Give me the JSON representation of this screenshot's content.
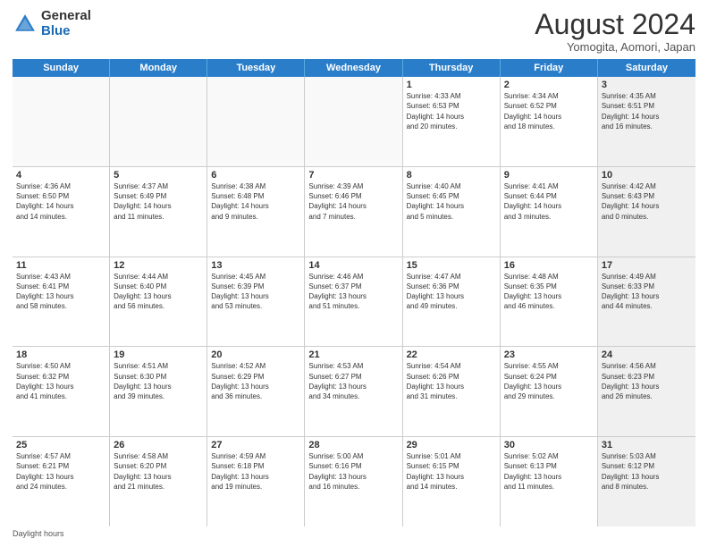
{
  "header": {
    "logo_general": "General",
    "logo_blue": "Blue",
    "month_year": "August 2024",
    "location": "Yomogita, Aomori, Japan"
  },
  "days_of_week": [
    "Sunday",
    "Monday",
    "Tuesday",
    "Wednesday",
    "Thursday",
    "Friday",
    "Saturday"
  ],
  "weeks": [
    [
      {
        "num": "",
        "text": "",
        "empty": true
      },
      {
        "num": "",
        "text": "",
        "empty": true
      },
      {
        "num": "",
        "text": "",
        "empty": true
      },
      {
        "num": "",
        "text": "",
        "empty": true
      },
      {
        "num": "1",
        "text": "Sunrise: 4:33 AM\nSunset: 6:53 PM\nDaylight: 14 hours\nand 20 minutes."
      },
      {
        "num": "2",
        "text": "Sunrise: 4:34 AM\nSunset: 6:52 PM\nDaylight: 14 hours\nand 18 minutes."
      },
      {
        "num": "3",
        "text": "Sunrise: 4:35 AM\nSunset: 6:51 PM\nDaylight: 14 hours\nand 16 minutes.",
        "shaded": true
      }
    ],
    [
      {
        "num": "4",
        "text": "Sunrise: 4:36 AM\nSunset: 6:50 PM\nDaylight: 14 hours\nand 14 minutes."
      },
      {
        "num": "5",
        "text": "Sunrise: 4:37 AM\nSunset: 6:49 PM\nDaylight: 14 hours\nand 11 minutes."
      },
      {
        "num": "6",
        "text": "Sunrise: 4:38 AM\nSunset: 6:48 PM\nDaylight: 14 hours\nand 9 minutes."
      },
      {
        "num": "7",
        "text": "Sunrise: 4:39 AM\nSunset: 6:46 PM\nDaylight: 14 hours\nand 7 minutes."
      },
      {
        "num": "8",
        "text": "Sunrise: 4:40 AM\nSunset: 6:45 PM\nDaylight: 14 hours\nand 5 minutes."
      },
      {
        "num": "9",
        "text": "Sunrise: 4:41 AM\nSunset: 6:44 PM\nDaylight: 14 hours\nand 3 minutes."
      },
      {
        "num": "10",
        "text": "Sunrise: 4:42 AM\nSunset: 6:43 PM\nDaylight: 14 hours\nand 0 minutes.",
        "shaded": true
      }
    ],
    [
      {
        "num": "11",
        "text": "Sunrise: 4:43 AM\nSunset: 6:41 PM\nDaylight: 13 hours\nand 58 minutes."
      },
      {
        "num": "12",
        "text": "Sunrise: 4:44 AM\nSunset: 6:40 PM\nDaylight: 13 hours\nand 56 minutes."
      },
      {
        "num": "13",
        "text": "Sunrise: 4:45 AM\nSunset: 6:39 PM\nDaylight: 13 hours\nand 53 minutes."
      },
      {
        "num": "14",
        "text": "Sunrise: 4:46 AM\nSunset: 6:37 PM\nDaylight: 13 hours\nand 51 minutes."
      },
      {
        "num": "15",
        "text": "Sunrise: 4:47 AM\nSunset: 6:36 PM\nDaylight: 13 hours\nand 49 minutes."
      },
      {
        "num": "16",
        "text": "Sunrise: 4:48 AM\nSunset: 6:35 PM\nDaylight: 13 hours\nand 46 minutes."
      },
      {
        "num": "17",
        "text": "Sunrise: 4:49 AM\nSunset: 6:33 PM\nDaylight: 13 hours\nand 44 minutes.",
        "shaded": true
      }
    ],
    [
      {
        "num": "18",
        "text": "Sunrise: 4:50 AM\nSunset: 6:32 PM\nDaylight: 13 hours\nand 41 minutes."
      },
      {
        "num": "19",
        "text": "Sunrise: 4:51 AM\nSunset: 6:30 PM\nDaylight: 13 hours\nand 39 minutes."
      },
      {
        "num": "20",
        "text": "Sunrise: 4:52 AM\nSunset: 6:29 PM\nDaylight: 13 hours\nand 36 minutes."
      },
      {
        "num": "21",
        "text": "Sunrise: 4:53 AM\nSunset: 6:27 PM\nDaylight: 13 hours\nand 34 minutes."
      },
      {
        "num": "22",
        "text": "Sunrise: 4:54 AM\nSunset: 6:26 PM\nDaylight: 13 hours\nand 31 minutes."
      },
      {
        "num": "23",
        "text": "Sunrise: 4:55 AM\nSunset: 6:24 PM\nDaylight: 13 hours\nand 29 minutes."
      },
      {
        "num": "24",
        "text": "Sunrise: 4:56 AM\nSunset: 6:23 PM\nDaylight: 13 hours\nand 26 minutes.",
        "shaded": true
      }
    ],
    [
      {
        "num": "25",
        "text": "Sunrise: 4:57 AM\nSunset: 6:21 PM\nDaylight: 13 hours\nand 24 minutes."
      },
      {
        "num": "26",
        "text": "Sunrise: 4:58 AM\nSunset: 6:20 PM\nDaylight: 13 hours\nand 21 minutes."
      },
      {
        "num": "27",
        "text": "Sunrise: 4:59 AM\nSunset: 6:18 PM\nDaylight: 13 hours\nand 19 minutes."
      },
      {
        "num": "28",
        "text": "Sunrise: 5:00 AM\nSunset: 6:16 PM\nDaylight: 13 hours\nand 16 minutes."
      },
      {
        "num": "29",
        "text": "Sunrise: 5:01 AM\nSunset: 6:15 PM\nDaylight: 13 hours\nand 14 minutes."
      },
      {
        "num": "30",
        "text": "Sunrise: 5:02 AM\nSunset: 6:13 PM\nDaylight: 13 hours\nand 11 minutes."
      },
      {
        "num": "31",
        "text": "Sunrise: 5:03 AM\nSunset: 6:12 PM\nDaylight: 13 hours\nand 8 minutes.",
        "shaded": true
      }
    ]
  ],
  "footer": {
    "note": "Daylight hours"
  }
}
